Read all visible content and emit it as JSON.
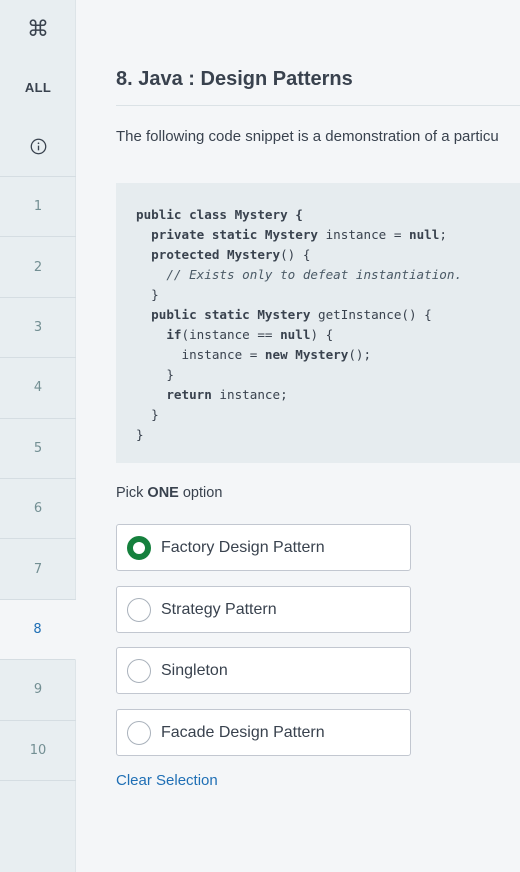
{
  "sidebar": {
    "cmd_symbol": "⌘",
    "all_label": "ALL",
    "questions": [
      "1",
      "2",
      "3",
      "4",
      "5",
      "6",
      "7",
      "8",
      "9",
      "10"
    ],
    "active_question": "8"
  },
  "question": {
    "title": "8. Java : Design Patterns",
    "description": "The following code snippet is a demonstration of a particu",
    "code": {
      "line1_kw": "public class",
      "line1_rest": " Mystery {",
      "line2_kw": "private static",
      "line2_type": " Mystery",
      "line2_rest": " instance = ",
      "line2_null": "null",
      "line2_end": ";",
      "line3_kw": "protected",
      "line3_name": " Mystery",
      "line3_rest": "() {",
      "line4_comment": "// Exists only to defeat instantiation.",
      "line5": "}",
      "line6_kw": "public static",
      "line6_type": " Mystery",
      "line6_rest": " getInstance() {",
      "line7_kw": "if",
      "line7_rest": "(instance == ",
      "line7_null": "null",
      "line7_end": ") {",
      "line8_pre": "instance = ",
      "line8_new": "new",
      "line8_type": " Mystery",
      "line8_end": "();",
      "line9": "}",
      "line10_kw": "return",
      "line10_rest": " instance;",
      "line11": "}",
      "line12": "}"
    },
    "pick_prefix": "Pick ",
    "pick_bold": "ONE",
    "pick_suffix": " option",
    "options": [
      {
        "label": "Factory Design Pattern",
        "selected": true
      },
      {
        "label": "Strategy Pattern",
        "selected": false
      },
      {
        "label": "Singleton",
        "selected": false
      },
      {
        "label": "Facade Design Pattern",
        "selected": false
      }
    ],
    "clear_label": "Clear Selection"
  },
  "colors": {
    "accent": "#1f6fb5",
    "selected_radio": "#15803d",
    "sidebar_bg": "#e8eef1",
    "code_bg": "#e6ecef"
  }
}
